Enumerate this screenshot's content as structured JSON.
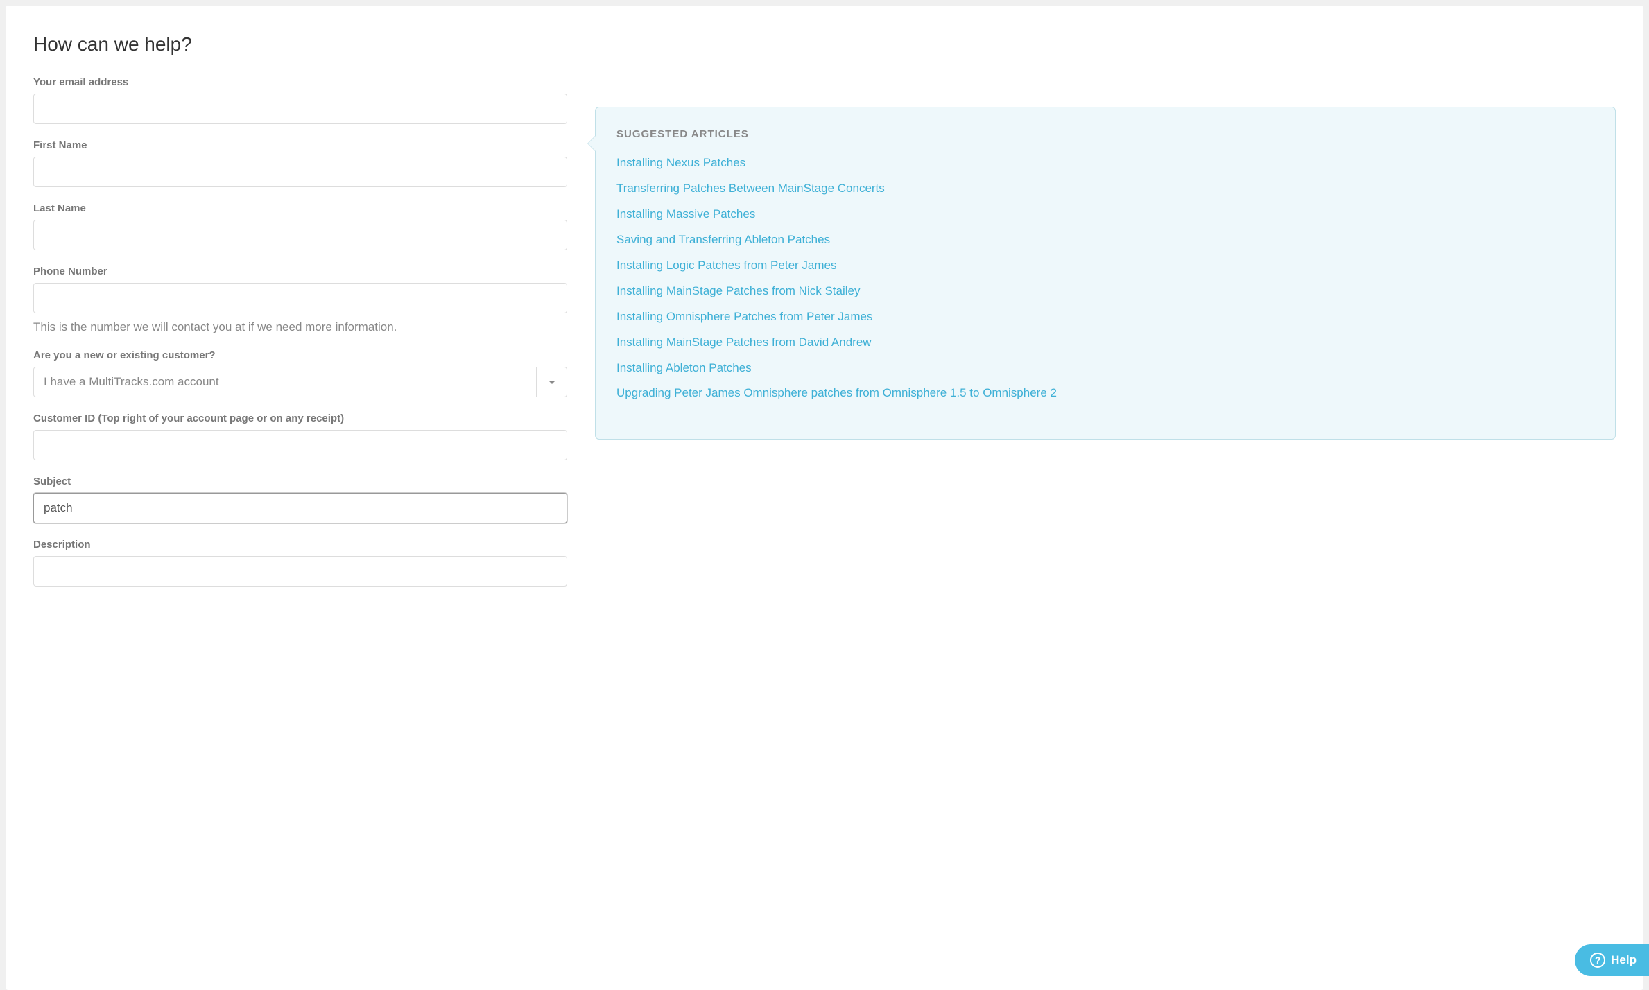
{
  "page": {
    "title": "How can we help?"
  },
  "form": {
    "email": {
      "label": "Your email address",
      "value": ""
    },
    "first_name": {
      "label": "First Name",
      "value": ""
    },
    "last_name": {
      "label": "Last Name",
      "value": ""
    },
    "phone": {
      "label": "Phone Number",
      "value": "",
      "hint": "This is the number we will contact you at if we need more information."
    },
    "customer_type": {
      "label": "Are you a new or existing customer?",
      "selected": "I have a MultiTracks.com account"
    },
    "customer_id": {
      "label": "Customer ID (Top right of your account page or on any receipt)",
      "value": ""
    },
    "subject": {
      "label": "Subject",
      "value": "patch"
    },
    "description": {
      "label": "Description",
      "value": ""
    }
  },
  "suggested": {
    "title": "Suggested Articles",
    "items": [
      "Installing Nexus Patches",
      "Transferring Patches Between MainStage Concerts",
      "Installing Massive Patches",
      "Saving and Transferring Ableton Patches",
      "Installing Logic Patches from Peter James",
      "Installing MainStage Patches from Nick Stailey",
      "Installing Omnisphere Patches from Peter James",
      "Installing MainStage Patches from David Andrew",
      "Installing Ableton Patches",
      "Upgrading Peter James Omnisphere patches from Omnisphere 1.5 to Omnisphere 2"
    ]
  },
  "help_widget": {
    "label": "Help"
  }
}
